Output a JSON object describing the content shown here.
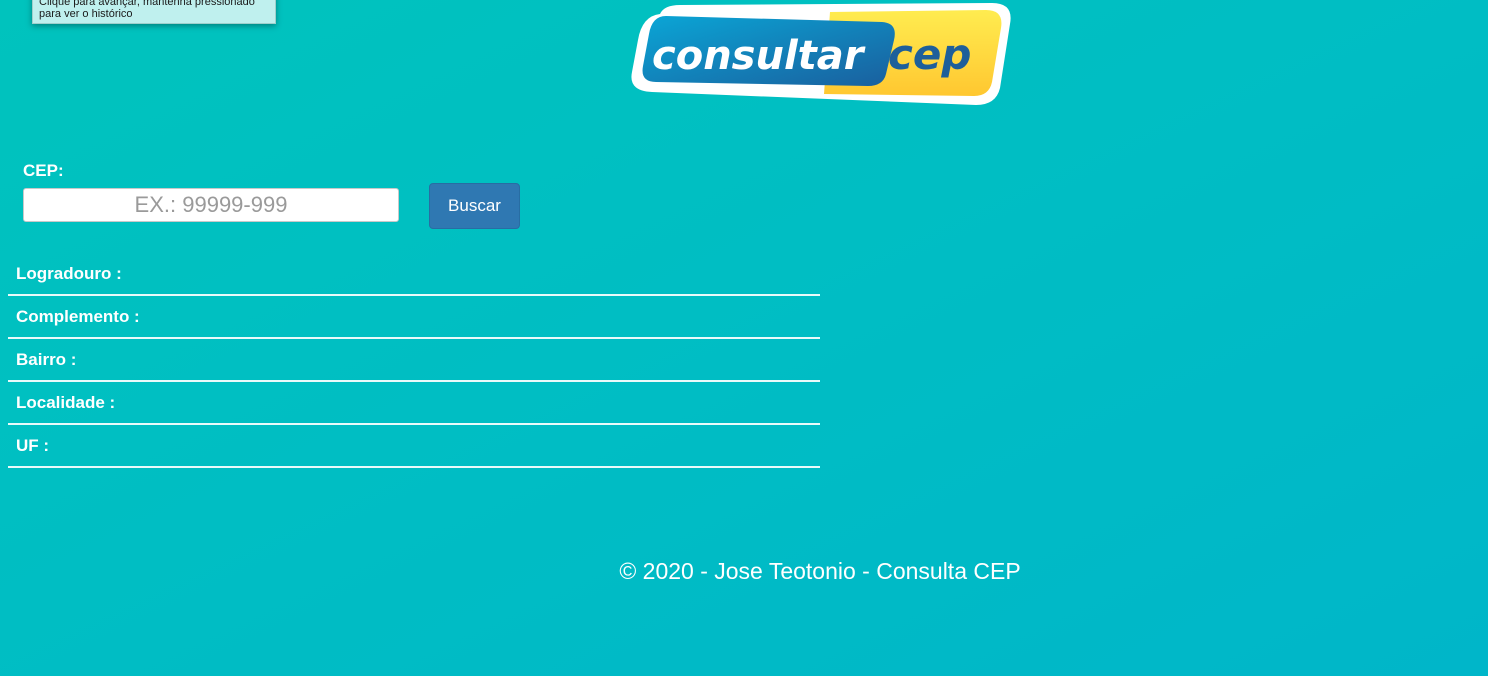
{
  "tooltip": {
    "line1": "Clique para avançar, mantenha pressionado",
    "line2": "para ver o histórico"
  },
  "logo": {
    "word1": "consultar",
    "word2": "cep",
    "colors": {
      "blue": "#0a7fc0",
      "yellow": "#ffd23a",
      "outline": "#ffffff"
    }
  },
  "form": {
    "cep_label": "CEP:",
    "cep_value": "",
    "cep_placeholder": "EX.: 99999-999",
    "search_button": "Buscar"
  },
  "results": [
    {
      "label": "Logradouro :",
      "value": ""
    },
    {
      "label": "Complemento :",
      "value": ""
    },
    {
      "label": "Bairro :",
      "value": ""
    },
    {
      "label": "Localidade :",
      "value": ""
    },
    {
      "label": "UF :",
      "value": ""
    }
  ],
  "footer": {
    "text": "© 2020 - Jose Teotonio - Consulta CEP"
  },
  "colors": {
    "background": "#00bec3",
    "button": "#2f78b2",
    "text": "#ffffff"
  }
}
